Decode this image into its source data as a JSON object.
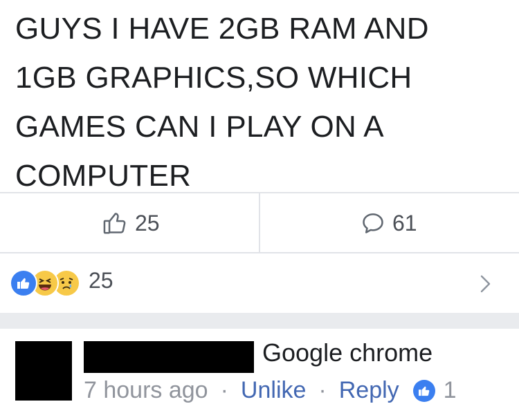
{
  "post": {
    "lines": [
      "GUYS I HAVE 2GB RAM AND",
      "1GB GRAPHICS,SO WHICH",
      "GAMES CAN I PLAY ON  A",
      "COMPUTER"
    ]
  },
  "stats": {
    "likes": "25",
    "comments": "61"
  },
  "reactions": {
    "count": "25",
    "types": [
      "like",
      "haha",
      "sad"
    ]
  },
  "comment": {
    "text": "Google chrome",
    "time": "7 hours ago",
    "unlike_label": "Unlike",
    "reply_label": "Reply",
    "like_count": "1",
    "separator": "·"
  },
  "colors": {
    "link": "#4267b2",
    "muted": "#90949c",
    "like_blue": "#3b7ff0",
    "emoji_yellow": "#f7c948"
  }
}
